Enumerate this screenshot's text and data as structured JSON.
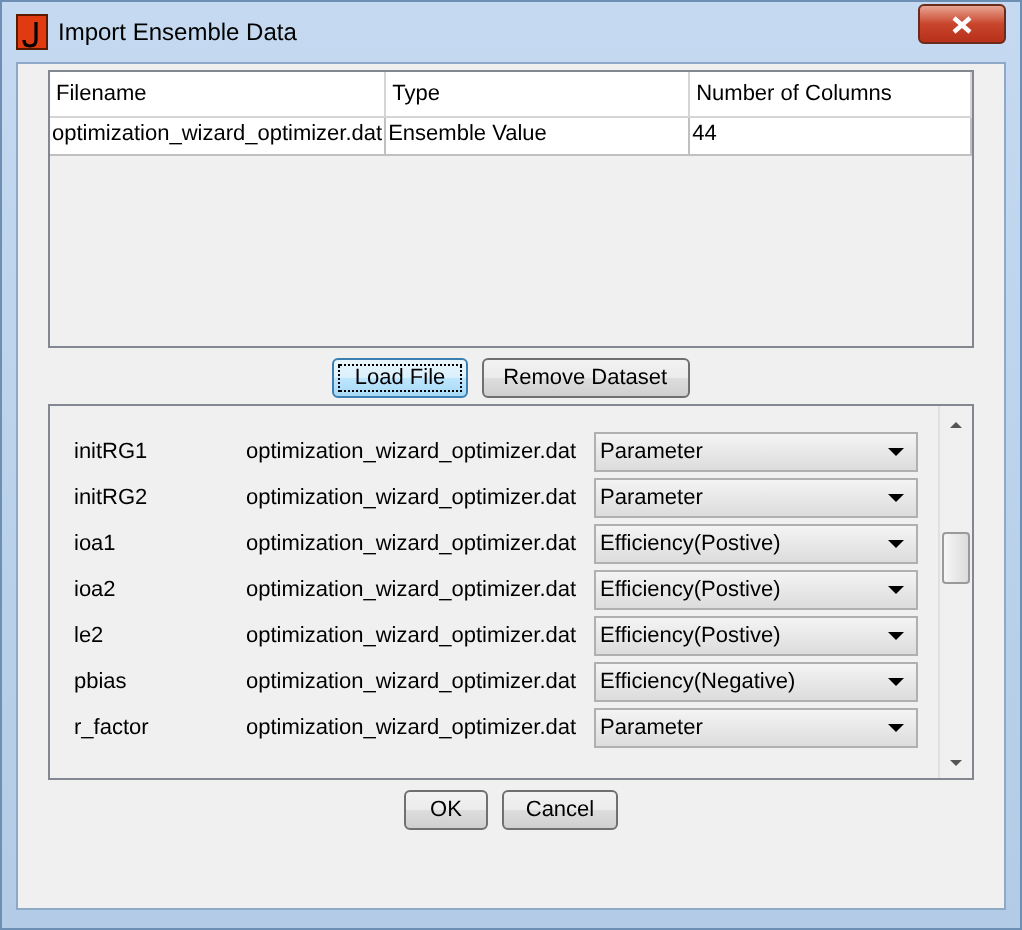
{
  "window": {
    "title": "Import Ensemble Data"
  },
  "files_table": {
    "columns": [
      "Filename",
      "Type",
      "Number of Columns"
    ],
    "rows": [
      {
        "cells": [
          "optimization_wizard_optimizer.dat",
          "Ensemble Value",
          "44"
        ],
        "selected": false
      }
    ]
  },
  "file_buttons": [
    {
      "label": "Load File",
      "focused": true
    },
    {
      "label": "Remove Dataset",
      "focused": false
    }
  ],
  "variables": [
    {
      "name": "initRG1",
      "file": "optimization_wizard_optimizer.dat",
      "type": "Parameter"
    },
    {
      "name": "initRG2",
      "file": "optimization_wizard_optimizer.dat",
      "type": "Parameter"
    },
    {
      "name": "ioa1",
      "file": "optimization_wizard_optimizer.dat",
      "type": "Efficiency(Postive)"
    },
    {
      "name": "ioa2",
      "file": "optimization_wizard_optimizer.dat",
      "type": "Efficiency(Postive)"
    },
    {
      "name": "le2",
      "file": "optimization_wizard_optimizer.dat",
      "type": "Efficiency(Postive)"
    },
    {
      "name": "pbias",
      "file": "optimization_wizard_optimizer.dat",
      "type": "Efficiency(Negative)"
    },
    {
      "name": "r_factor",
      "file": "optimization_wizard_optimizer.dat",
      "type": "Parameter"
    }
  ],
  "dialog_buttons": [
    {
      "label": "OK",
      "focused": false
    },
    {
      "label": "Cancel",
      "focused": false
    }
  ]
}
